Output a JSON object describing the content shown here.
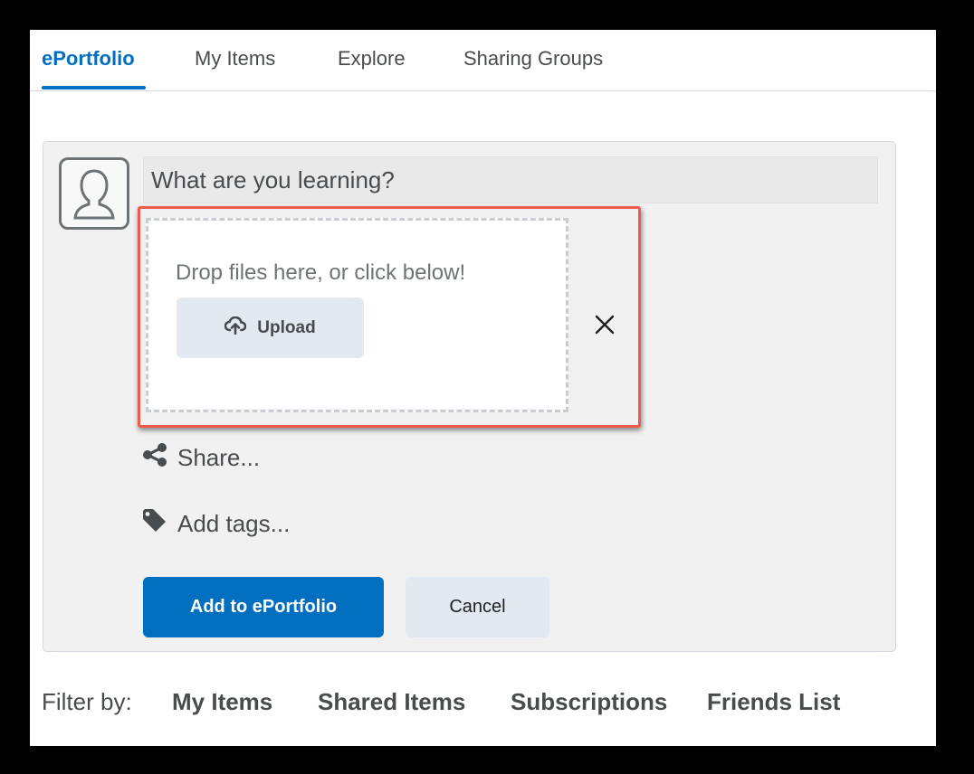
{
  "tabs": [
    {
      "label": "ePortfolio",
      "active": true
    },
    {
      "label": "My Items",
      "active": false
    },
    {
      "label": "Explore",
      "active": false
    },
    {
      "label": "Sharing Groups",
      "active": false
    }
  ],
  "composer": {
    "avatar_icon": "user-avatar-icon",
    "placeholder": "What are you learning?",
    "dropzone": {
      "text": "Drop files here, or click below!",
      "upload_label": "Upload",
      "upload_icon": "cloud-upload-icon",
      "close_icon": "close-icon"
    },
    "share_label": "Share...",
    "share_icon": "share-icon",
    "tags_label": "Add tags...",
    "tags_icon": "tag-icon",
    "primary_button": "Add to ePortfolio",
    "cancel_button": "Cancel"
  },
  "filter": {
    "label": "Filter by:",
    "options": [
      "My Items",
      "Shared Items",
      "Subscriptions",
      "Friends List"
    ]
  },
  "colors": {
    "accent": "#006fbf",
    "highlight": "#ef5a4c",
    "card_background": "#f1f1f2",
    "secondary_button": "#e3e9f1"
  }
}
